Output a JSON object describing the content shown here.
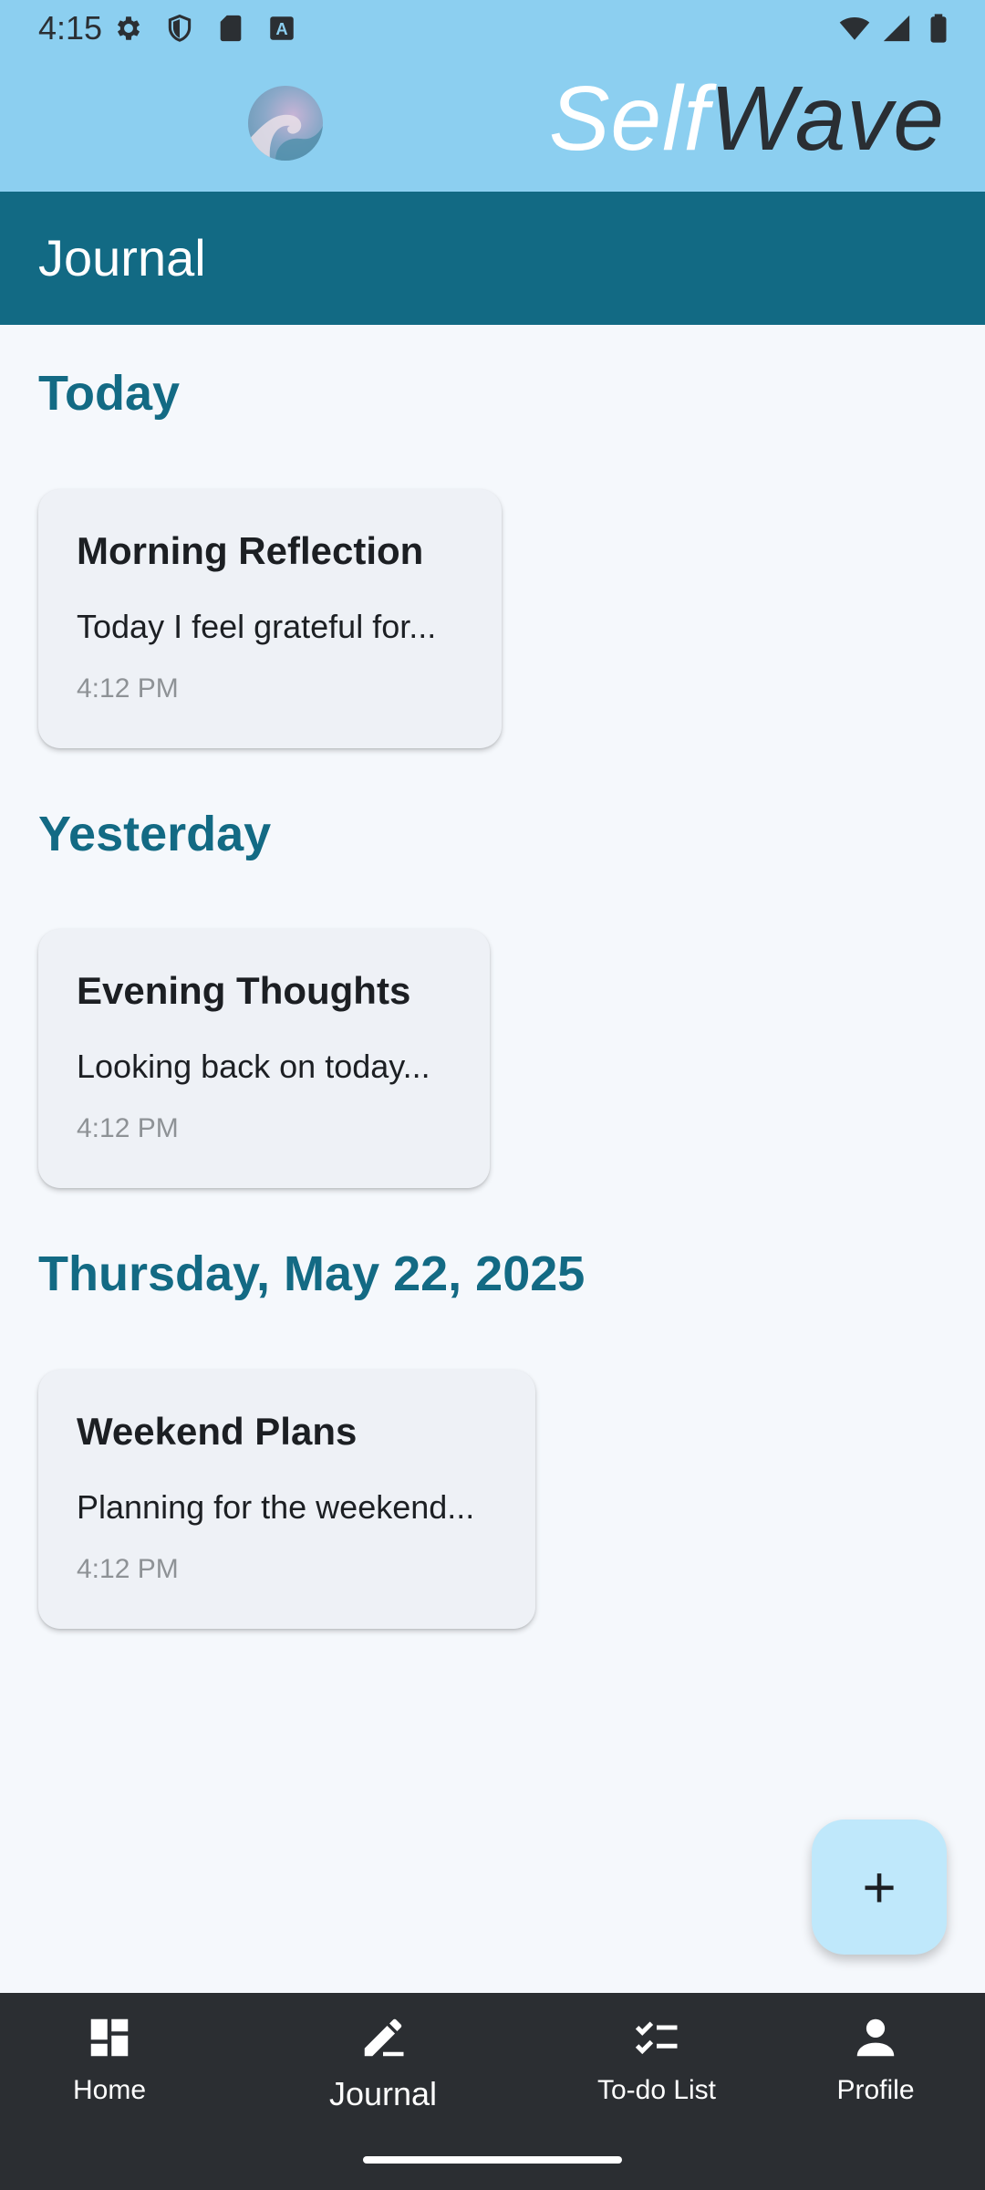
{
  "status_bar": {
    "time": "4:15"
  },
  "header": {
    "brand_part1": "Self",
    "brand_part2": "Wave"
  },
  "page": {
    "title": "Journal"
  },
  "sections": [
    {
      "heading": "Today",
      "entry": {
        "title": "Morning Reflection",
        "preview": "Today I feel grateful for...",
        "time": "4:12 PM"
      }
    },
    {
      "heading": "Yesterday",
      "entry": {
        "title": "Evening Thoughts",
        "preview": "Looking back on today...",
        "time": "4:12 PM"
      }
    },
    {
      "heading": "Thursday, May 22, 2025",
      "entry": {
        "title": "Weekend Plans",
        "preview": "Planning for the weekend...",
        "time": "4:12 PM"
      }
    }
  ],
  "fab": {
    "icon": "plus-icon",
    "label": "+"
  },
  "nav": [
    {
      "label": "Home",
      "icon": "dashboard-icon"
    },
    {
      "label": "Journal",
      "icon": "pencil-icon",
      "active": true
    },
    {
      "label": "To-do List",
      "icon": "checklist-icon"
    },
    {
      "label": "Profile",
      "icon": "person-icon"
    }
  ],
  "colors": {
    "header_bg": "#8ccff0",
    "title_bar_bg": "#126a84",
    "accent_text": "#136a84",
    "nav_bg": "#2b2e32",
    "fab_bg": "#bfe8fb"
  }
}
